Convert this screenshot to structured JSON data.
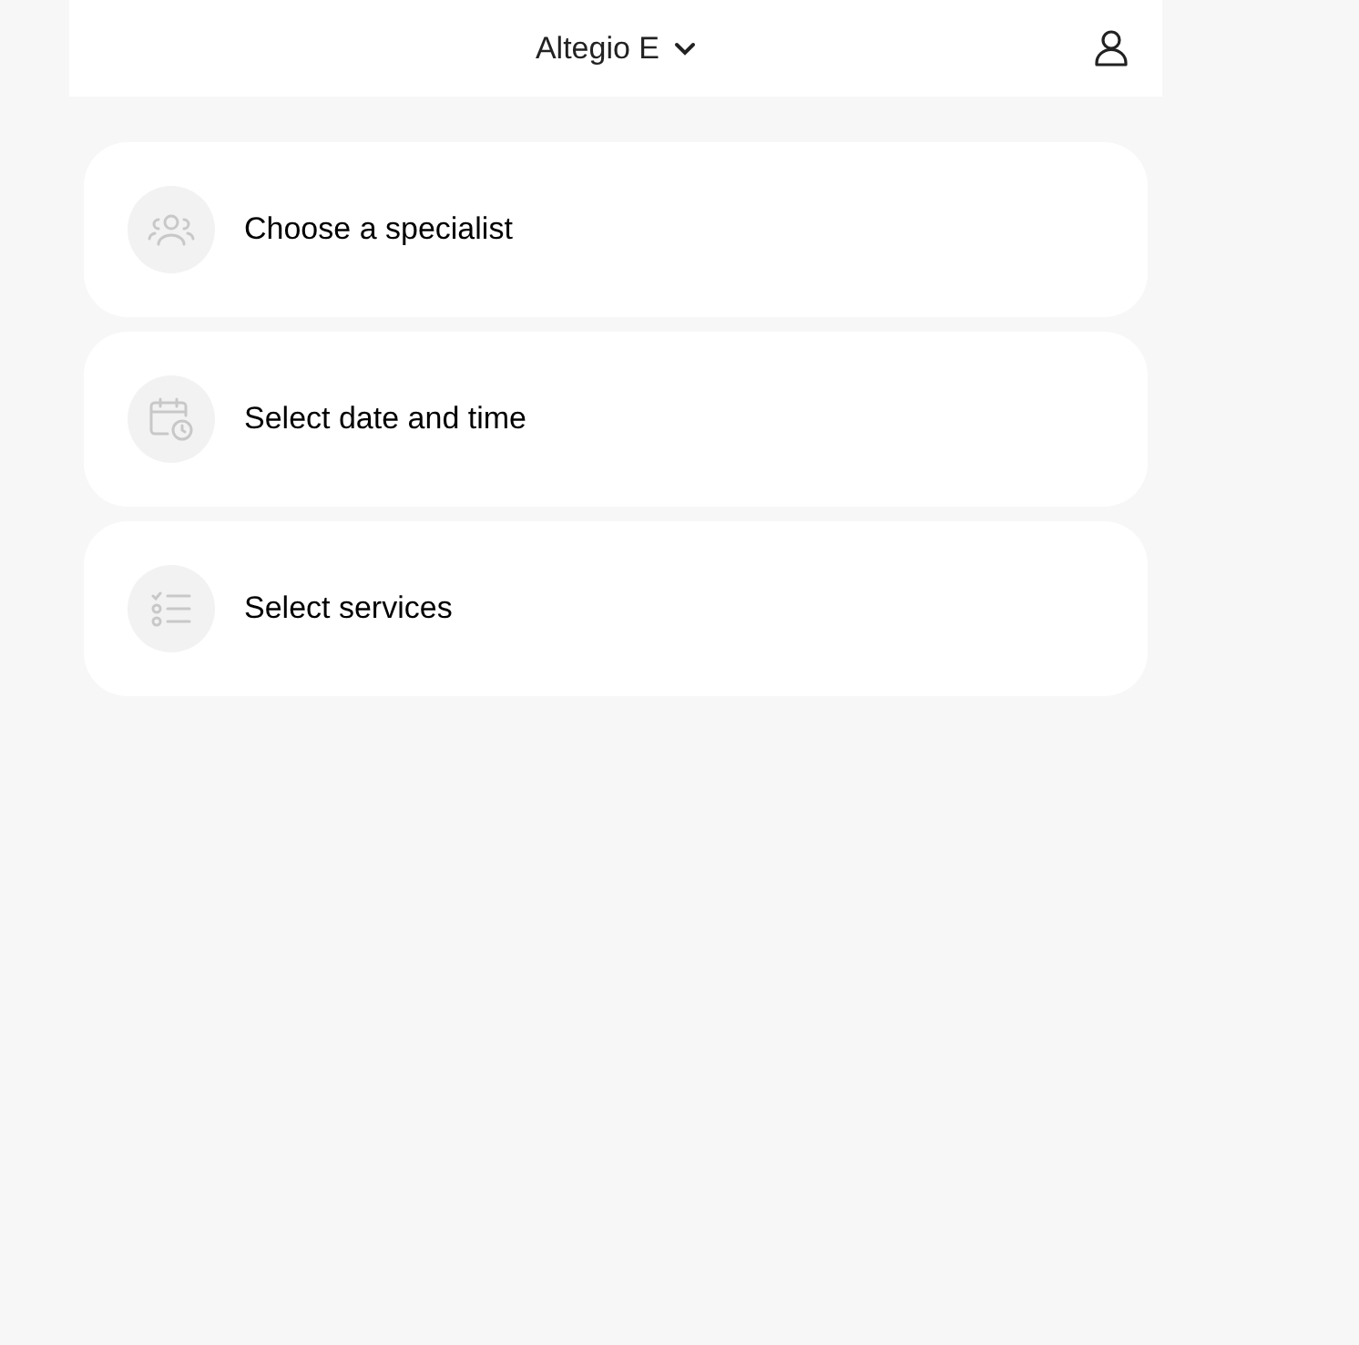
{
  "header": {
    "title": "Altegio E"
  },
  "steps": [
    {
      "kind": "specialist",
      "label": "Choose a specialist"
    },
    {
      "kind": "datetime",
      "label": "Select date and time"
    },
    {
      "kind": "services",
      "label": "Select services"
    }
  ]
}
